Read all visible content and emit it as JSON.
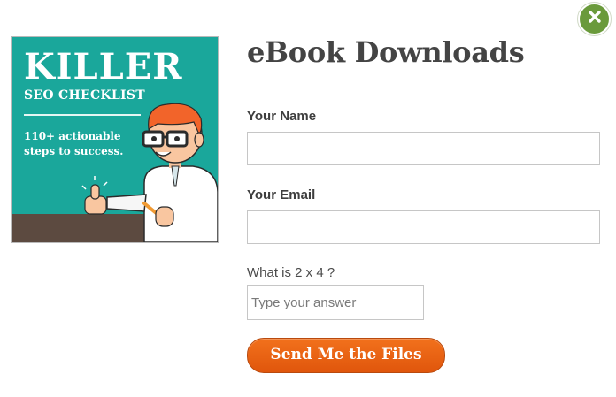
{
  "modal": {
    "title": "eBook Downloads",
    "close_icon": "close-icon",
    "colors": {
      "close": "#6a9a3b",
      "cover_bg": "#1aa79b",
      "button": "#e9600f"
    }
  },
  "cover": {
    "title": "KILLER",
    "subtitle": "SEO CHECKLIST",
    "tagline": "110+ actionable steps to success."
  },
  "form": {
    "name_label": "Your Name",
    "email_label": "Your Email",
    "question": "What is 2 x 4 ?",
    "answer_placeholder": "Type your answer",
    "submit_label": "Send Me the Files"
  }
}
